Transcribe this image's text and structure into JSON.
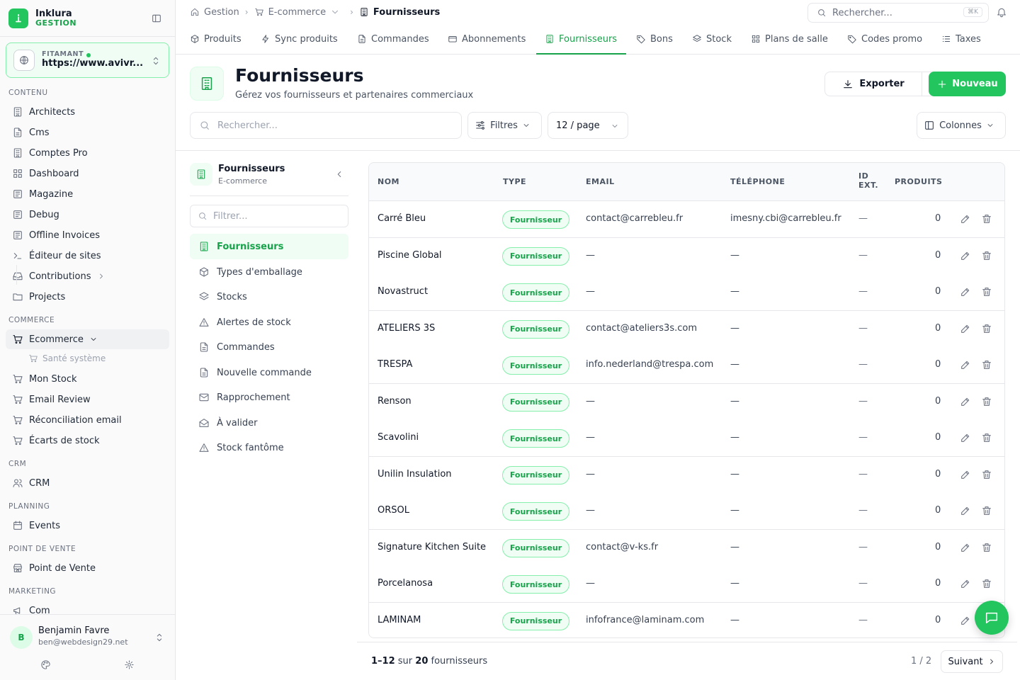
{
  "brand": {
    "name": "Inklura",
    "sub": "GESTION"
  },
  "site": {
    "label": "FITAMANT",
    "url": "https://www.avivr..."
  },
  "sidebar": {
    "sections": [
      {
        "title": "CONTENU"
      },
      {
        "title": "COMMERCE"
      },
      {
        "title": "CRM"
      },
      {
        "title": "PLANNING"
      },
      {
        "title": "POINT DE VENTE"
      },
      {
        "title": "MARKETING"
      }
    ],
    "items": [
      {
        "label": "Architects",
        "icon": "building-icon"
      },
      {
        "label": "Cms",
        "icon": "file-icon"
      },
      {
        "label": "Comptes Pro",
        "icon": "building-icon"
      },
      {
        "label": "Dashboard",
        "icon": "grid-icon"
      },
      {
        "label": "Magazine",
        "icon": "newspaper-icon"
      },
      {
        "label": "Debug",
        "icon": "newspaper-icon"
      },
      {
        "label": "Offline Invoices",
        "icon": "newspaper-icon"
      },
      {
        "label": "Éditeur de sites",
        "icon": "terminal-icon"
      },
      {
        "label": "Contributions",
        "icon": "inbox-icon"
      },
      {
        "label": "Projects",
        "icon": "folder-icon"
      },
      {
        "label": "Ecommerce",
        "icon": "cart-icon"
      },
      {
        "label": "Santé système",
        "icon": "cart-icon"
      },
      {
        "label": "Mon Stock",
        "icon": "cart-icon"
      },
      {
        "label": "Email Review",
        "icon": "cart-icon"
      },
      {
        "label": "Réconciliation email",
        "icon": "cart-icon"
      },
      {
        "label": "Écarts de stock",
        "icon": "cart-icon"
      },
      {
        "label": "CRM",
        "icon": "users-icon"
      },
      {
        "label": "Events",
        "icon": "calendar-icon"
      },
      {
        "label": "Point de Vente",
        "icon": "store-icon"
      },
      {
        "label": "Com",
        "icon": "megaphone-icon"
      }
    ]
  },
  "user": {
    "initial": "B",
    "name": "Benjamin Favre",
    "email": "ben@webdesign29.net"
  },
  "breadcrumb": {
    "items": [
      "Gestion",
      "E-commerce",
      "Fournisseurs"
    ]
  },
  "topsearch": {
    "placeholder": "Rechercher...",
    "shortcut": "⌘K"
  },
  "tabs": [
    {
      "label": "Produits"
    },
    {
      "label": "Sync produits"
    },
    {
      "label": "Commandes"
    },
    {
      "label": "Abonnements"
    },
    {
      "label": "Fournisseurs"
    },
    {
      "label": "Bons"
    },
    {
      "label": "Stock"
    },
    {
      "label": "Plans de salle"
    },
    {
      "label": "Codes promo"
    },
    {
      "label": "Taxes"
    }
  ],
  "page": {
    "title": "Fournisseurs",
    "subtitle": "Gérez vos fournisseurs et partenaires commerciaux",
    "export_label": "Exporter",
    "new_label": "Nouveau",
    "search_placeholder": "Rechercher...",
    "filters_label": "Filtres",
    "per_page_label": "12 / page",
    "columns_label": "Colonnes"
  },
  "panel": {
    "title": "Fournisseurs",
    "subtitle": "E-commerce",
    "filter_placeholder": "Filtrer...",
    "items": [
      {
        "label": "Fournisseurs",
        "icon": "building-icon"
      },
      {
        "label": "Types d'emballage",
        "icon": "box-icon"
      },
      {
        "label": "Stocks",
        "icon": "layers-icon"
      },
      {
        "label": "Alertes de stock",
        "icon": "alert-icon"
      },
      {
        "label": "Commandes",
        "icon": "file-icon"
      },
      {
        "label": "Nouvelle commande",
        "icon": "file-icon"
      },
      {
        "label": "Rapprochement",
        "icon": "mail-icon"
      },
      {
        "label": "À valider",
        "icon": "mail-open-icon"
      },
      {
        "label": "Stock fantôme",
        "icon": "alert-icon"
      }
    ]
  },
  "table": {
    "headers": {
      "name": "NOM",
      "type": "TYPE",
      "email": "EMAIL",
      "phone": "TÉLÉPHONE",
      "ext1": "ID",
      "ext2": "EXT.",
      "products": "PRODUITS"
    },
    "rows": [
      {
        "name": "Carré Bleu",
        "type": "Fournisseur",
        "email": "contact@carrebleu.fr",
        "phone": "imesny.cbi@carrebleu.fr",
        "ext": "—",
        "products": "0"
      },
      {
        "name": "Piscine Global",
        "type": "Fournisseur",
        "email": "—",
        "phone": "—",
        "ext": "—",
        "products": "0"
      },
      {
        "name": "Novastruct",
        "type": "Fournisseur",
        "email": "—",
        "phone": "—",
        "ext": "—",
        "products": "0"
      },
      {
        "name": "ATELIERS 3S",
        "type": "Fournisseur",
        "email": "contact@ateliers3s.com",
        "phone": "—",
        "ext": "—",
        "products": "0"
      },
      {
        "name": "TRESPA",
        "type": "Fournisseur",
        "email": "info.nederland@trespa.com",
        "phone": "—",
        "ext": "—",
        "products": "0"
      },
      {
        "name": "Renson",
        "type": "Fournisseur",
        "email": "—",
        "phone": "—",
        "ext": "—",
        "products": "0"
      },
      {
        "name": "Scavolini",
        "type": "Fournisseur",
        "email": "—",
        "phone": "—",
        "ext": "—",
        "products": "0"
      },
      {
        "name": "Unilin Insulation",
        "type": "Fournisseur",
        "email": "—",
        "phone": "—",
        "ext": "—",
        "products": "0"
      },
      {
        "name": "ORSOL",
        "type": "Fournisseur",
        "email": "—",
        "phone": "—",
        "ext": "—",
        "products": "0"
      },
      {
        "name": "Signature Kitchen Suite",
        "type": "Fournisseur",
        "email": "contact@v-ks.fr",
        "phone": "—",
        "ext": "—",
        "products": "0"
      },
      {
        "name": "Porcelanosa",
        "type": "Fournisseur",
        "email": "—",
        "phone": "—",
        "ext": "—",
        "products": "0"
      },
      {
        "name": "LAMINAM",
        "type": "Fournisseur",
        "email": "infofrance@laminam.com",
        "phone": "—",
        "ext": "—",
        "products": "0"
      }
    ]
  },
  "pagination": {
    "range": "1–12",
    "of_label": "sur",
    "total": "20",
    "unit": "fournisseurs",
    "page_indicator": "1 / 2",
    "next_label": "Suivant"
  },
  "colors": {
    "accent": "#22c55e",
    "accent_dark": "#16a34a",
    "accent_bg": "#f0fdf4",
    "border": "#e5e7eb"
  }
}
